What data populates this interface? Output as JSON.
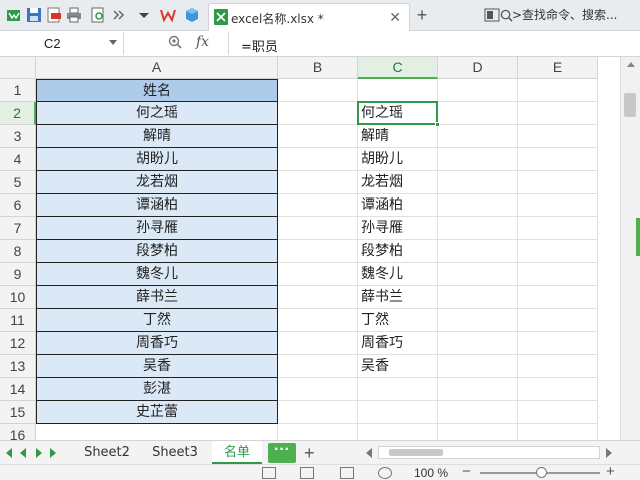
{
  "titlebar": {
    "doc_title": "excel名称.xlsx *",
    "search_placeholder": ">查找命令、搜索..."
  },
  "formula_bar": {
    "name_box": "C2",
    "fx_label": "fx",
    "formula": "=职员"
  },
  "columns": [
    "A",
    "B",
    "C",
    "D",
    "E"
  ],
  "active_column": "C",
  "rows": [
    "1",
    "2",
    "3",
    "4",
    "5",
    "6",
    "7",
    "8",
    "9",
    "10",
    "11",
    "12",
    "13",
    "14",
    "15",
    "16"
  ],
  "active_row": "2",
  "column_a": [
    "姓名",
    "何之瑶",
    "解晴",
    "胡盼儿",
    "龙若烟",
    "谭涵柏",
    "孙寻雁",
    "段梦柏",
    "魏冬儿",
    "薛书兰",
    "丁然",
    "周香巧",
    "吴香",
    "彭湛",
    "史芷蕾"
  ],
  "column_c": [
    "",
    "何之瑶",
    "解晴",
    "胡盼儿",
    "龙若烟",
    "谭涵柏",
    "孙寻雁",
    "段梦柏",
    "魏冬儿",
    "薛书兰",
    "丁然",
    "周香巧",
    "吴香"
  ],
  "sheets": [
    "Sheet2",
    "Sheet3",
    "名单"
  ],
  "active_sheet": "名单",
  "tab_more": "···",
  "tab_add": "+",
  "status": {
    "zoom": "100 %"
  },
  "colors": {
    "accent": "#4caf50",
    "header_fill": "#aecbea",
    "list_fill": "#dbe8f6"
  }
}
